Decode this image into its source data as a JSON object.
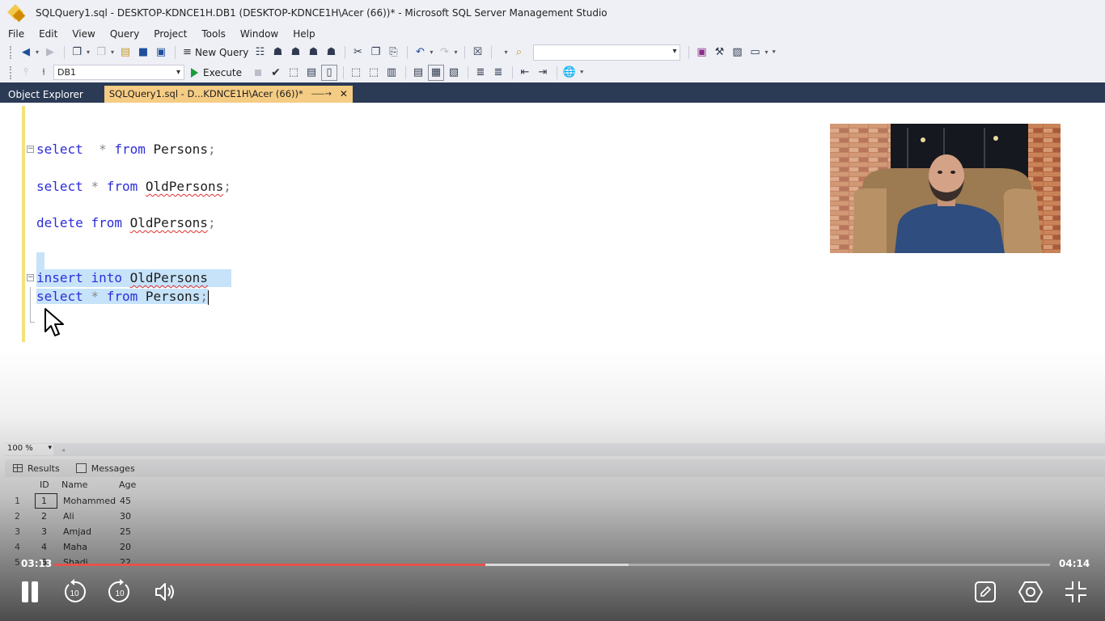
{
  "window": {
    "title": "SQLQuery1.sql - DESKTOP-KDNCE1H.DB1 (DESKTOP-KDNCE1H\\Acer (66))* - Microsoft SQL Server Management Studio"
  },
  "menu": {
    "items": [
      "File",
      "Edit",
      "View",
      "Query",
      "Project",
      "Tools",
      "Window",
      "Help"
    ]
  },
  "toolbar": {
    "new_query_label": "New Query",
    "execute_label": "Execute",
    "database_selected": "DB1"
  },
  "tabs": {
    "object_explorer": "Object Explorer",
    "query_tab": "SQLQuery1.sql - D...KDNCE1H\\Acer (66))*"
  },
  "editor": {
    "lines": [
      {
        "kw1": "select",
        "sep1": "  ",
        "op": "*",
        "sep2": " ",
        "kw2": "from",
        "sep3": " ",
        "ident": "Persons",
        "end": ";"
      },
      {
        "kw1": "select",
        "sep1": " ",
        "op": "*",
        "sep2": " ",
        "kw2": "from",
        "sep3": " ",
        "ident": "OldPersons",
        "end": ";"
      },
      {
        "kw1": "delete",
        "sep1": " ",
        "kw2": "from",
        "sep3": " ",
        "ident": "OldPersons",
        "end": ";"
      },
      {
        "kw1": "insert",
        "sep1": " ",
        "kw2": "into",
        "sep3": " ",
        "ident": "OldPersons",
        "end": " "
      },
      {
        "kw1": "select",
        "sep1": " ",
        "op": "*",
        "sep2": " ",
        "kw2": "from",
        "sep3": " ",
        "ident": "Persons",
        "end": ";"
      }
    ]
  },
  "zoom": {
    "level": "100 %"
  },
  "results": {
    "tab_results": "Results",
    "tab_messages": "Messages",
    "columns": [
      "ID",
      "Name",
      "Age"
    ],
    "rows": [
      {
        "num": "1",
        "id": "1",
        "name": "Mohammed",
        "age": "45"
      },
      {
        "num": "2",
        "id": "2",
        "name": "Ali",
        "age": "30"
      },
      {
        "num": "3",
        "id": "3",
        "name": "Amjad",
        "age": "25"
      },
      {
        "num": "4",
        "id": "4",
        "name": "Maha",
        "age": "20"
      },
      {
        "num": "5",
        "id": "5",
        "name": "Shadi",
        "age": "22"
      }
    ]
  },
  "player": {
    "current_time": "03:13",
    "total_time": "04:14",
    "played_fraction": 0.433,
    "buffered_fraction": 0.577,
    "skip_seconds": "10",
    "colors": {
      "progress": "#e5534b"
    }
  },
  "icons": {
    "toolbar1": [
      "back-icon",
      "forward-icon",
      "new-project-icon",
      "add-item-icon",
      "open-file-icon",
      "save-icon",
      "save-all-icon",
      "new-query-icon",
      "mdx-query-icon",
      "dmx-query-icon",
      "xmla-query-icon",
      "dax-query-icon",
      "cut-icon",
      "copy-icon",
      "paste-icon",
      "undo-icon",
      "redo-icon",
      "activity-monitor-icon",
      "find-icon",
      "solution-explorer-icon",
      "properties-icon",
      "toolbox-icon",
      "command-window-icon"
    ],
    "toolbar2": [
      "connect-icon",
      "change-connection-icon",
      "execute-icon",
      "stop-icon",
      "parse-icon",
      "display-plan-icon",
      "results-to-text-icon",
      "results-to-grid-icon",
      "results-to-file-icon",
      "comment-icon",
      "uncomment-icon",
      "decrease-indent-icon",
      "increase-indent-icon",
      "specify-values-icon"
    ],
    "player": [
      "pause-icon",
      "rewind-10-icon",
      "forward-10-icon",
      "volume-icon",
      "annotate-icon",
      "settings-icon",
      "exit-fullscreen-icon"
    ]
  }
}
